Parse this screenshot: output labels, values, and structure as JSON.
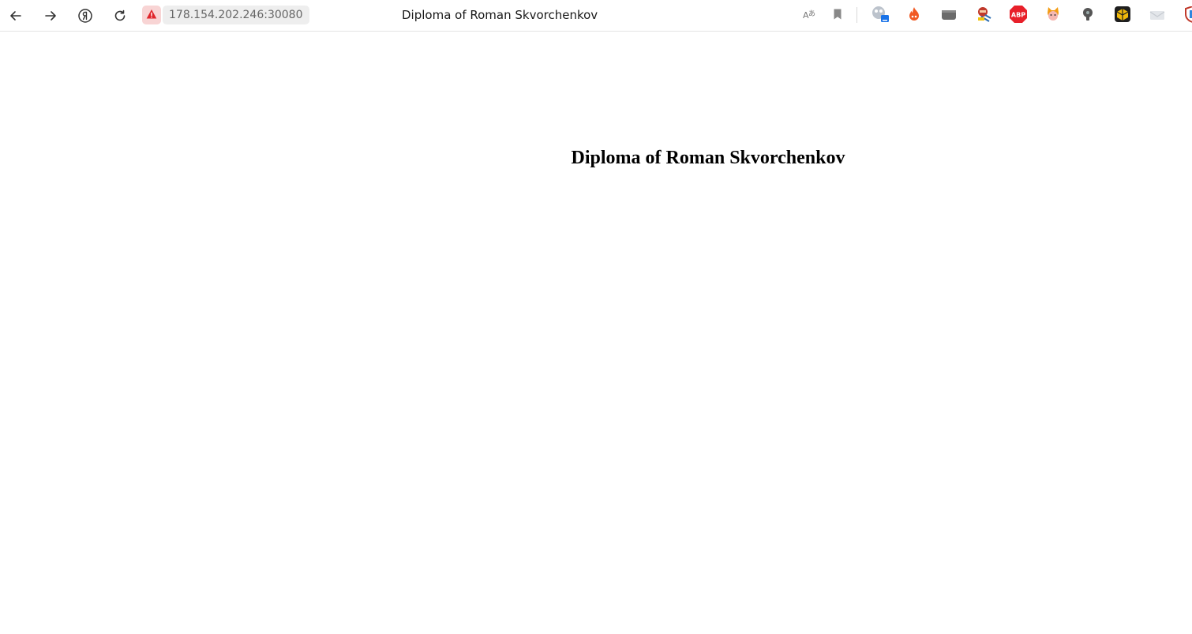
{
  "browser": {
    "address": "178.154.202.246:30080",
    "tab_title": "Diploma of Roman Skvorchenkov",
    "extensions": [
      {
        "name": "translate-icon"
      },
      {
        "name": "bookmark-icon"
      },
      {
        "name": "extension-dashboard-icon"
      },
      {
        "name": "flame-extension-icon"
      },
      {
        "name": "tray-extension-icon"
      },
      {
        "name": "brush-extension-icon"
      },
      {
        "name": "adblock-icon",
        "label": "ABP"
      },
      {
        "name": "cat-extension-icon"
      },
      {
        "name": "bulb-extension-icon"
      },
      {
        "name": "box-extension-icon"
      },
      {
        "name": "mail-extension-icon"
      }
    ]
  },
  "page": {
    "heading": "Diploma of Roman Skvorchenkov"
  },
  "colors": {
    "warning": "#e0242a",
    "abp": "#e8202a",
    "text": "#000000"
  }
}
